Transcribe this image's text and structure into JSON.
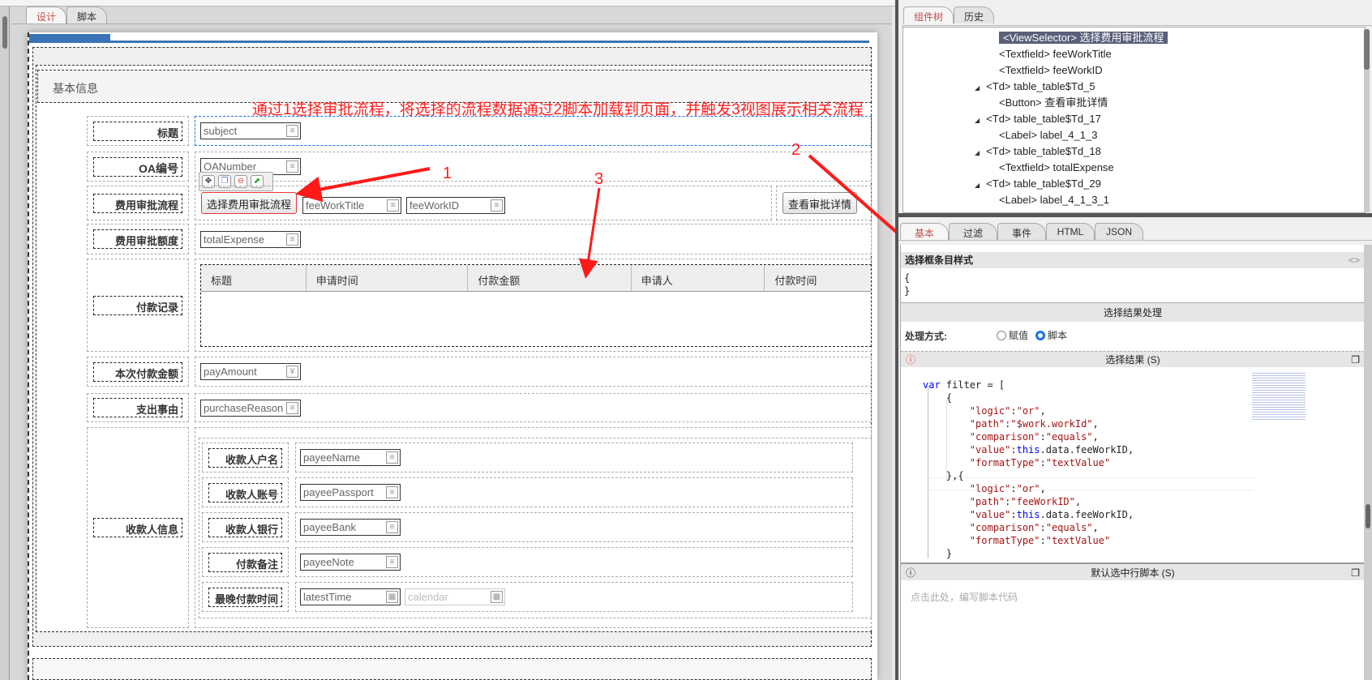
{
  "left_tabs": [
    {
      "label": "设计",
      "active": true
    },
    {
      "label": "脚本",
      "active": false
    }
  ],
  "annotation": {
    "text": "通过1选择审批流程，将选择的流程数据通过2脚本加载到页面，并触发3视图展示相关流程",
    "n1": "1",
    "n2": "2",
    "n3": "3",
    "color": "#ff2020"
  },
  "form": {
    "section_title": "基本信息",
    "subject_label": "标题",
    "subject_value": "subject",
    "oa_label": "OA编号",
    "oa_value": "OANumber",
    "flow_label": "费用审批流程",
    "flow_button": "选择费用审批流程",
    "fee_title": "feeWorkTitle",
    "fee_id": "feeWorkID",
    "view_button": "查看审批详情",
    "expense_label": "费用审批额度",
    "expense_value": "totalExpense",
    "records_label": "付款记录",
    "records_columns": [
      "标题",
      "申请时间",
      "付款金额",
      "申请人",
      "付款时间"
    ],
    "pay_label": "本次付款金额",
    "pay_value": "payAmount",
    "reason_label": "支出事由",
    "reason_value": "purchaseReason",
    "payee_label": "收款人信息",
    "payee_rows": [
      {
        "label": "收款人户名",
        "value": "payeeName"
      },
      {
        "label": "收款人账号",
        "value": "payeePassport"
      },
      {
        "label": "收款人银行",
        "value": "payeeBank"
      },
      {
        "label": "付款备注",
        "value": "payeeNote"
      },
      {
        "label": "最晚付款时间",
        "value": "latestTime",
        "extra": "calendar"
      }
    ]
  },
  "right_tabs": [
    {
      "label": "组件树",
      "active": true
    },
    {
      "label": "历史",
      "active": false
    }
  ],
  "tree": [
    {
      "text": "<ViewSelector> 选择费用审批流程",
      "selected": true
    },
    {
      "text": "<Textfield> feeWorkTitle"
    },
    {
      "text": "<Textfield> feeWorkID"
    },
    {
      "text": "<Td> table_table$Td_5",
      "expand": true
    },
    {
      "text": "<Button> 查看审批详情"
    },
    {
      "text": "<Td> table_table$Td_17",
      "expand": true
    },
    {
      "text": "<Label> label_4_1_3"
    },
    {
      "text": "<Td> table_table$Td_18",
      "expand": true
    },
    {
      "text": "<Textfield> totalExpense"
    },
    {
      "text": "<Td> table_table$Td_29",
      "expand": true
    },
    {
      "text": "<Label> label_4_1_3_1"
    }
  ],
  "prop_tabs": [
    {
      "label": "基本",
      "active": true
    },
    {
      "label": "过滤"
    },
    {
      "label": "事件"
    },
    {
      "label": "HTML"
    },
    {
      "label": "JSON"
    }
  ],
  "props": {
    "item_style_title": "选择框条目样式",
    "item_style_open": "{",
    "item_style_close": "}",
    "result_handling": "选择结果处理",
    "mode_label": "处理方式:",
    "mode_assign": "赋值",
    "mode_script": "脚本",
    "mode_selected": "脚本",
    "result_title": "选择结果 (S)",
    "code_lines": [
      "var filter = [",
      "    {",
      "        \"logic\":\"or\",",
      "        \"path\":\"$work.workId\",",
      "        \"comparison\":\"equals\",",
      "        \"value\":this.data.feeWorkID,",
      "        \"formatType\":\"textValue\"",
      "    },{",
      "        \"logic\":\"or\",",
      "        \"path\":\"feeWorkID\",",
      "        \"value\":this.data.feeWorkID,",
      "        \"comparison\":\"equals\",",
      "        \"formatType\":\"textValue\"",
      "    }"
    ],
    "default_script_title": "默认选中行脚本 (S)",
    "default_script_placeholder": "点击此处，编写脚本代码"
  }
}
